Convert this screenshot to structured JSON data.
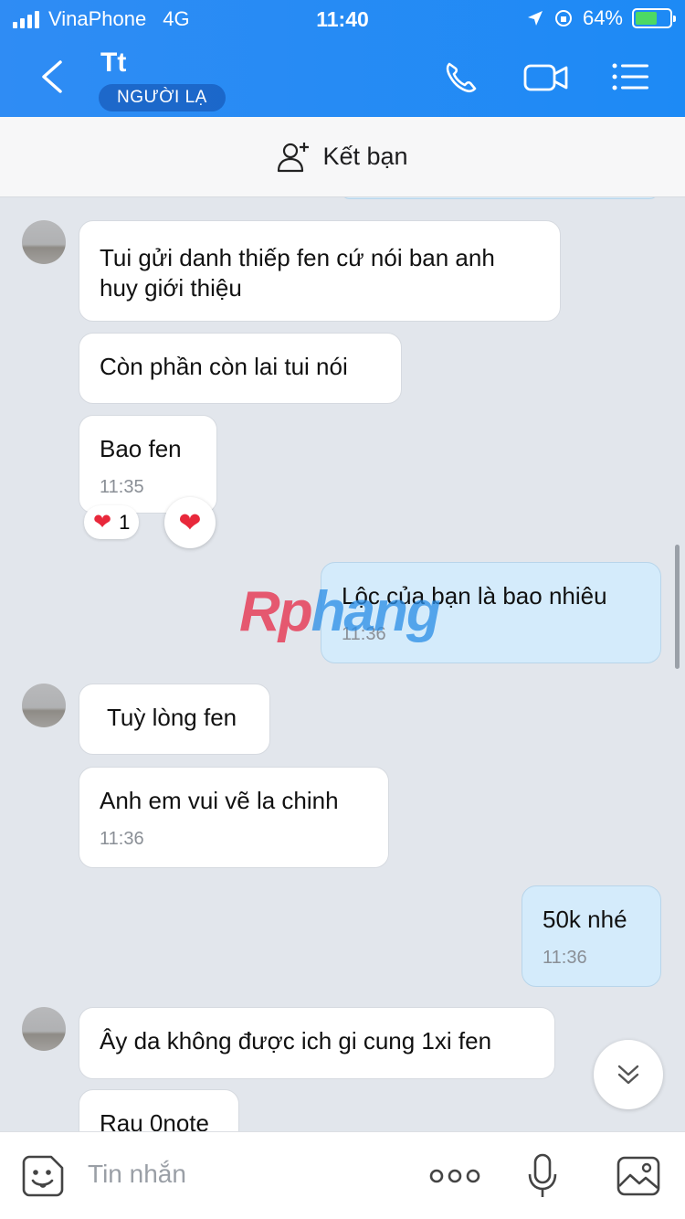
{
  "status_bar": {
    "carrier": "VinaPhone",
    "network": "4G",
    "time": "11:40",
    "battery": "64%",
    "battery_level": 0.64
  },
  "header": {
    "title": "Tt",
    "badge": "NGƯỜI LẠ"
  },
  "add_friend": {
    "label": "Kết bạn"
  },
  "messages": [
    {
      "sender": "other",
      "lines": [
        "Tui gửi danh thiếp fen cứ nói ban anh",
        "huy giới thiệu"
      ]
    },
    {
      "sender": "other",
      "text": "Còn phần còn lai tui nói"
    },
    {
      "sender": "other",
      "text": "Bao fen",
      "time": "11:35",
      "reaction_count": "1"
    },
    {
      "sender": "me",
      "text": "Lộc của bạn là bao nhiêu",
      "time": "11:36"
    },
    {
      "sender": "other",
      "text": "Tuỳ lòng fen"
    },
    {
      "sender": "other",
      "text": "Anh em vui vẽ la chinh",
      "time": "11:36"
    },
    {
      "sender": "me",
      "text": "50k nhé",
      "time": "11:36"
    },
    {
      "sender": "other",
      "text": "Ây da không được ich gi cung 1xi fen"
    },
    {
      "sender": "other",
      "text": "Rau 0note"
    }
  ],
  "watermark": {
    "part1": "Rp",
    "part2": "hang"
  },
  "input": {
    "placeholder": "Tin nhắn"
  },
  "colors": {
    "header": "#2f8cf4",
    "my_bubble": "#d4ebfb",
    "background": "#e2e6ec"
  }
}
